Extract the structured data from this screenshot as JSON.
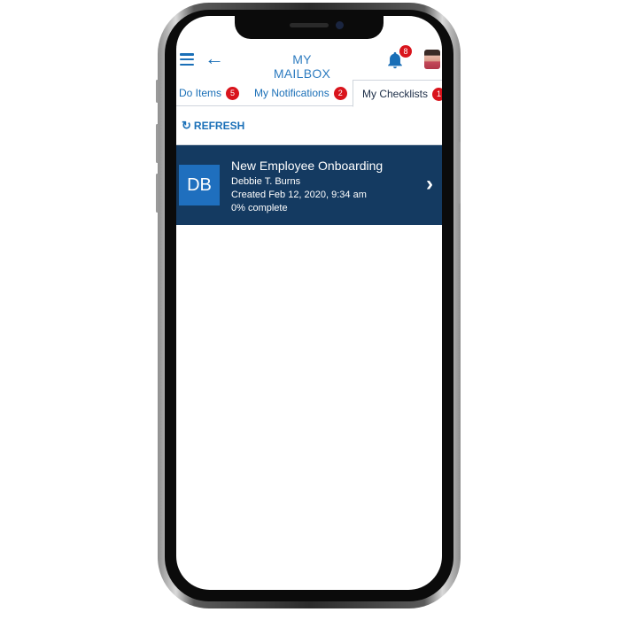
{
  "header": {
    "title": "MY MAILBOX",
    "notification_count": "8",
    "menu_icon": "hamburger-icon",
    "back_icon": "arrow-left-icon",
    "bell_icon": "bell-icon"
  },
  "tabs": [
    {
      "label": "Do Items",
      "count": "5"
    },
    {
      "label": "My Notifications",
      "count": "2"
    },
    {
      "label": "My Checklists",
      "count": "1",
      "active": true
    }
  ],
  "refresh": {
    "label": "REFRESH",
    "icon": "refresh-icon"
  },
  "checklist_items": [
    {
      "initials": "DB",
      "title": "New Employee Onboarding",
      "owner": "Debbie T. Burns",
      "created": "Created Feb 12, 2020, 9:34 am",
      "progress": "0% complete"
    }
  ],
  "colors": {
    "accent": "#1a6fb7",
    "item_background": "#143a61",
    "initials_background": "#1f6fbe",
    "badge": "#d9141c"
  }
}
